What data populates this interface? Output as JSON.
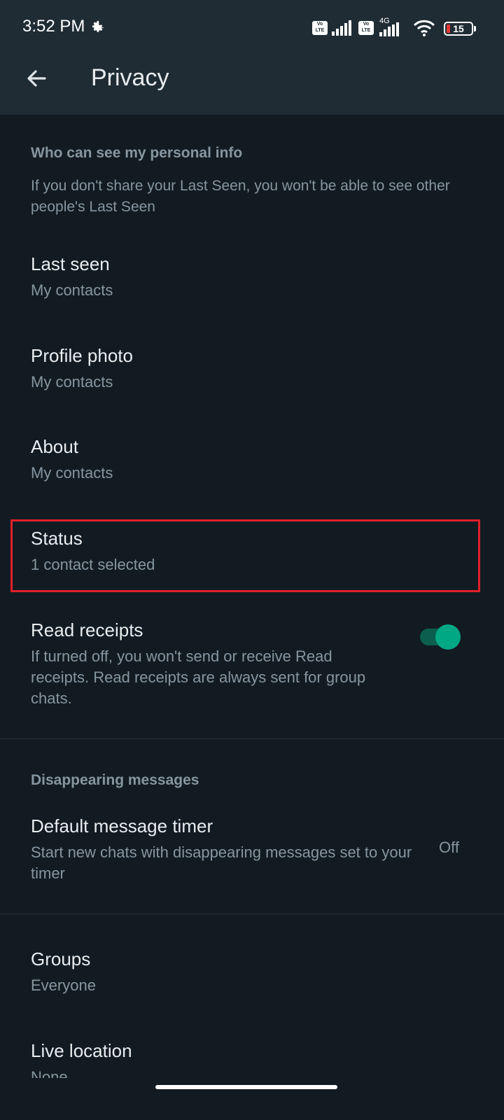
{
  "status_bar": {
    "time": "3:52 PM",
    "network": "4G",
    "volte_label": "Vo LTE",
    "battery_level": "15"
  },
  "header": {
    "title": "Privacy"
  },
  "sections": {
    "personal_info_header": "Who can see my personal info",
    "personal_info_note": "If you don't share your Last Seen, you won't be able to see other people's Last Seen",
    "disappearing_header": "Disappearing messages"
  },
  "items": {
    "last_seen": {
      "title": "Last seen",
      "value": "My contacts"
    },
    "profile_photo": {
      "title": "Profile photo",
      "value": "My contacts"
    },
    "about": {
      "title": "About",
      "value": "My contacts"
    },
    "status": {
      "title": "Status",
      "value": "1 contact selected"
    },
    "read_receipts": {
      "title": "Read receipts",
      "description": "If turned off, you won't send or receive Read receipts. Read receipts are always sent for group chats.",
      "enabled": true
    },
    "default_timer": {
      "title": "Default message timer",
      "description": "Start new chats with disappearing messages set to your timer",
      "value": "Off"
    },
    "groups": {
      "title": "Groups",
      "value": "Everyone"
    },
    "live_location": {
      "title": "Live location",
      "value": "None"
    }
  },
  "colors": {
    "background": "#121b22",
    "app_bar": "#1f2c34",
    "accent": "#00a884",
    "highlight_box": "#e0202a"
  }
}
